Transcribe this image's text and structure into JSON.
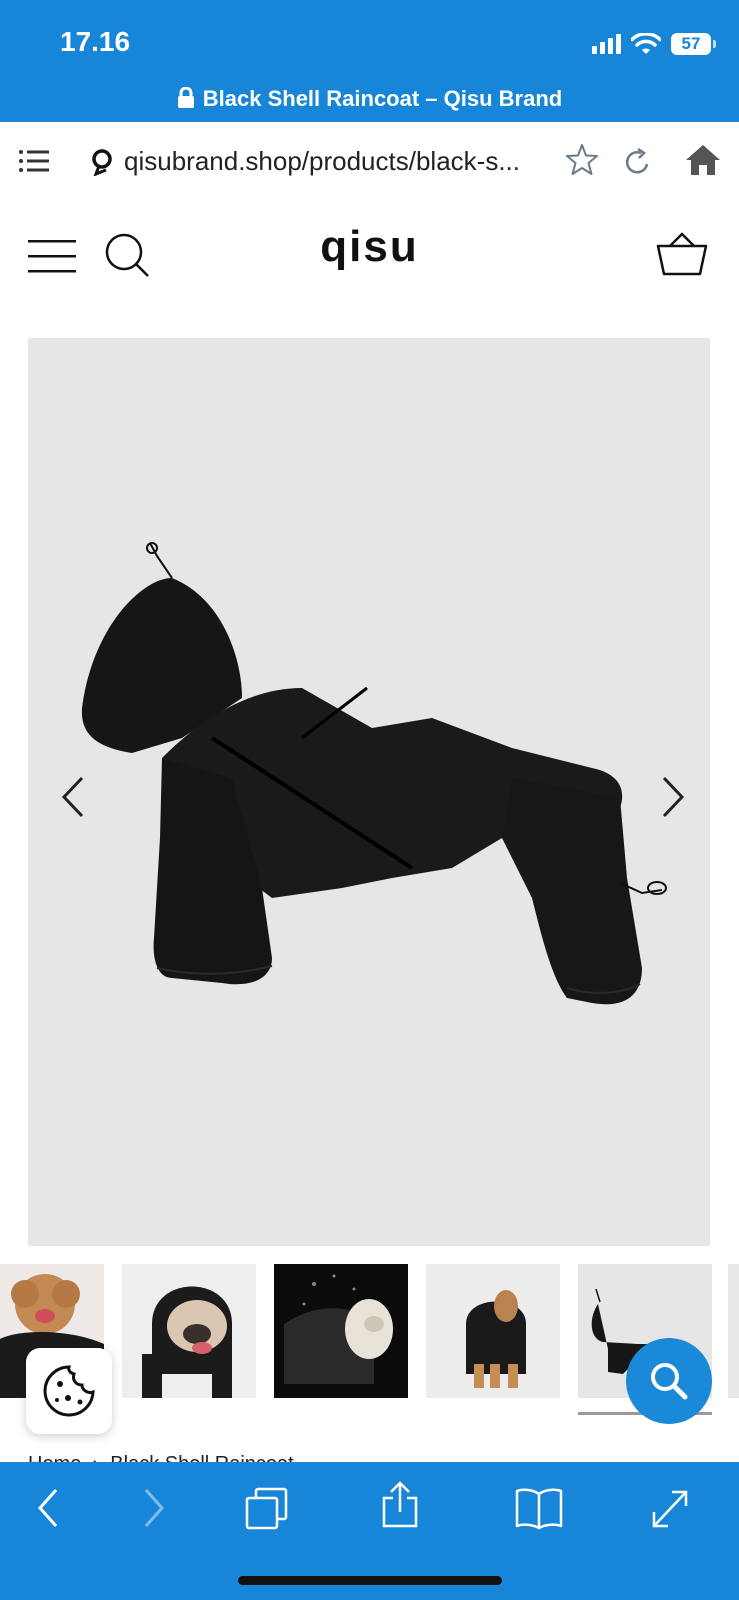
{
  "status_bar": {
    "time": "17.16",
    "battery_level": "57",
    "icons": [
      "signal-icon",
      "wifi-icon",
      "battery-icon"
    ]
  },
  "browser": {
    "page_title": "Black Shell Raincoat – Qisu Brand",
    "url": "qisubrand.shop/products/black-s...",
    "icons": [
      "lock-icon",
      "tabs-menu-icon",
      "search-engine-icon",
      "bookmark-star-icon",
      "reload-icon",
      "home-icon"
    ]
  },
  "shop_header": {
    "logo": "qisu",
    "icons": [
      "hamburger-menu-icon",
      "search-icon",
      "basket-icon"
    ]
  },
  "product": {
    "name": "Black Shell Raincoat",
    "gallery": {
      "main_image": "black raincoat product photo",
      "thumbnails": [
        "poodle wearing raincoat",
        "french bulldog wearing raincoat",
        "dog in rain wearing raincoat",
        "dog standing in raincoat",
        "raincoat product photo"
      ],
      "selected_index": 4
    }
  },
  "breadcrumb": {
    "home": "Home",
    "separator": "›",
    "current": "Black Shell Raincoat"
  },
  "floating": {
    "cookie": "cookie-icon",
    "search": "search-icon"
  },
  "bottom_toolbar": {
    "icons": [
      "back-icon",
      "forward-icon",
      "tabs-icon",
      "share-icon",
      "bookmarks-icon",
      "fullscreen-icon"
    ]
  },
  "colors": {
    "browser_chrome": "#1886d8",
    "stage_bg": "#e6e6e6",
    "fab": "#1a8ad8"
  }
}
